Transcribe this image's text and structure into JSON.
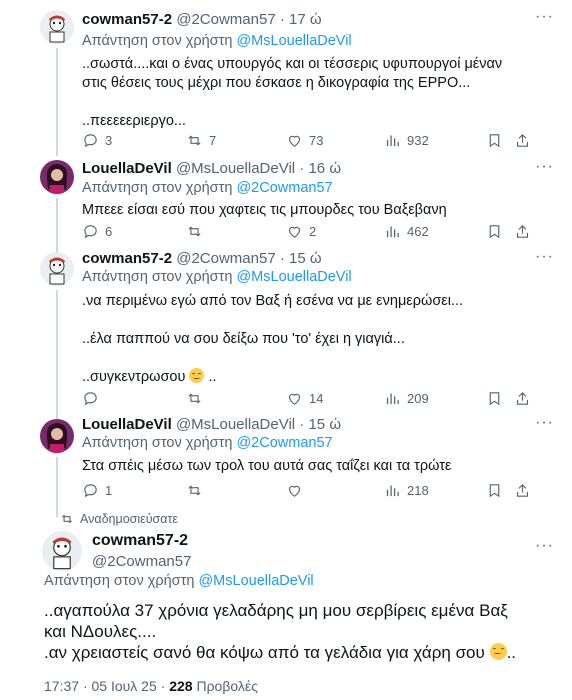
{
  "replies": [
    {
      "name": "cowman57-2",
      "handle": "@2Cowman57",
      "time": "17 ώ",
      "reply_prefix": "Απάντηση στον χρήστη",
      "reply_mention": "@MsLouellaDeVil",
      "lines": [
        "..σωστά....και ο ένας υπουργός και οι τέσσερις υφυπουργοί μέναν",
        "στις θέσεις τους μέχρι που έσκασε η δικογραφία της ΕΡΡΟ...",
        "",
        "..πεεεεεριεργο..."
      ],
      "stats": {
        "replies": "3",
        "reposts": "7",
        "likes": "73",
        "views": "932"
      },
      "avatar": "cowman-avatar"
    },
    {
      "name": "LouellaDeVil",
      "handle": "@MsLouellaDeVil",
      "time": "16 ώ",
      "reply_prefix": "Απάντηση στον χρήστη",
      "reply_mention": "@2Cowman57",
      "lines": [
        "Μπεεε είσαι εσύ που χαφτεις τις μπουρδες του Βαξεβανη"
      ],
      "stats": {
        "replies": "6",
        "reposts": "",
        "likes": "2",
        "views": "462"
      },
      "avatar": "louella-avatar"
    },
    {
      "name": "cowman57-2",
      "handle": "@2Cowman57",
      "time": "15 ώ",
      "reply_prefix": "Απάντηση στον χρήστη",
      "reply_mention": "@MsLouellaDeVil",
      "lines": [
        ".να περιμένω εγώ από τον Βαξ ή εσένα να με ενημερώσει...",
        "",
        "..έλα παππού να σου δείξω που 'το' έχει η γιαγιά...",
        "",
        "..συγκεντρωσου"
      ],
      "emoji_suffix": "..",
      "stats": {
        "replies": "",
        "reposts": "",
        "likes": "14",
        "views": "209"
      },
      "avatar": "cowman-avatar"
    },
    {
      "name": "LouellaDeVil",
      "handle": "@MsLouellaDeVil",
      "time": "15 ώ",
      "reply_prefix": "Απάντηση στον χρήστη",
      "reply_mention": "@2Cowman57",
      "lines": [
        "Στα σπέις μέσω των τρολ του αυτά σας ταΐζει και τα τρώτε"
      ],
      "stats": {
        "replies": "1",
        "reposts": "",
        "likes": "",
        "views": "218"
      },
      "avatar": "louella-avatar"
    }
  ],
  "main": {
    "reposted_label": "Αναδημοσιεύσατε",
    "name": "cowman57-2",
    "handle": "@2Cowman57",
    "reply_prefix": "Απάντηση στον χρήστη",
    "reply_mention": "@MsLouellaDeVil",
    "line1": "..αγαπούλα 37 χρόνια γελαδάρης μη μου σερβίρεις εμένα Βαξ",
    "line2": "και ΝΔουλες....",
    "line3": ".αν χρειαστείς σανό θα κόψω από τα γελάδια για χάρη σου",
    "line3_suffix": "..",
    "time": "17:37",
    "date": "05 Ιουλ 25",
    "views": "228",
    "views_label": "Προβολές"
  },
  "colors": {
    "accent": "#1d9bf0",
    "muted": "#536471",
    "text": "#0f1419"
  }
}
